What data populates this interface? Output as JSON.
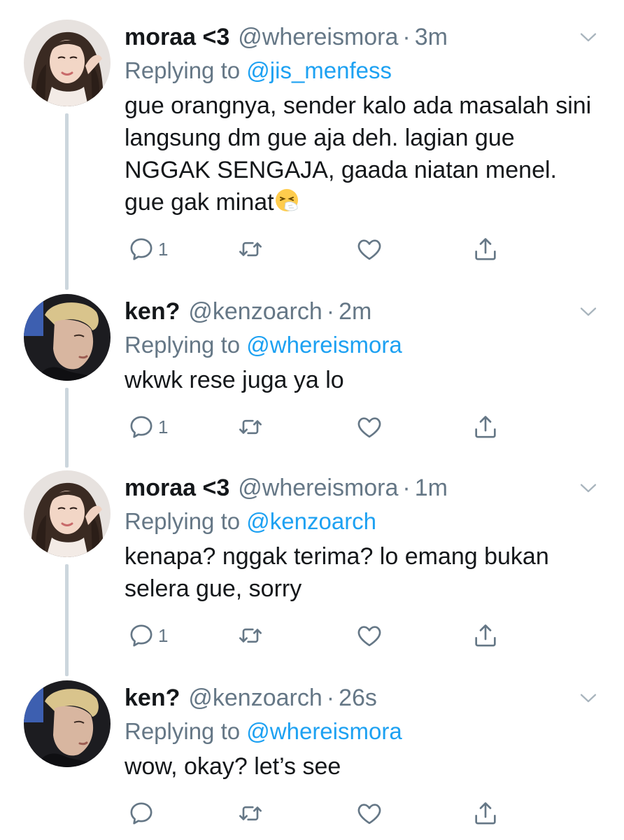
{
  "tweets": [
    {
      "name": "moraa <3",
      "handle": "@whereismora",
      "time": "3m",
      "replying_label": "Replying to",
      "replying_to": "@jis_menfess",
      "text": "gue orangnya, sender kalo ada masalah sini langsung dm gue aja deh. lagian gue NGGAK SENGAJA, gaada niatan menel. gue gak minat",
      "emoji": "sneezing-face-emoji",
      "reply_count": "1"
    },
    {
      "name": "ken?",
      "handle": "@kenzoarch",
      "time": "2m",
      "replying_label": "Replying to",
      "replying_to": "@whereismora",
      "text": "wkwk rese juga ya lo",
      "reply_count": "1"
    },
    {
      "name": "moraa <3",
      "handle": "@whereismora",
      "time": "1m",
      "replying_label": "Replying to",
      "replying_to": "@kenzoarch",
      "text": "kenapa? nggak terima? lo emang bukan selera gue, sorry",
      "reply_count": "1"
    },
    {
      "name": "ken?",
      "handle": "@kenzoarch",
      "time": "26s",
      "replying_label": "Replying to",
      "replying_to": "@whereismora",
      "text": "wow, okay? let’s see",
      "reply_count": ""
    }
  ],
  "separator": "·",
  "icons": {
    "reply": "reply-icon",
    "retweet": "retweet-icon",
    "like": "heart-icon",
    "share": "share-icon",
    "more": "chevron-down-icon"
  },
  "colors": {
    "link": "#1da1f2",
    "muted": "#657786",
    "text": "#14171a",
    "thread_line": "#ccd6dd"
  }
}
